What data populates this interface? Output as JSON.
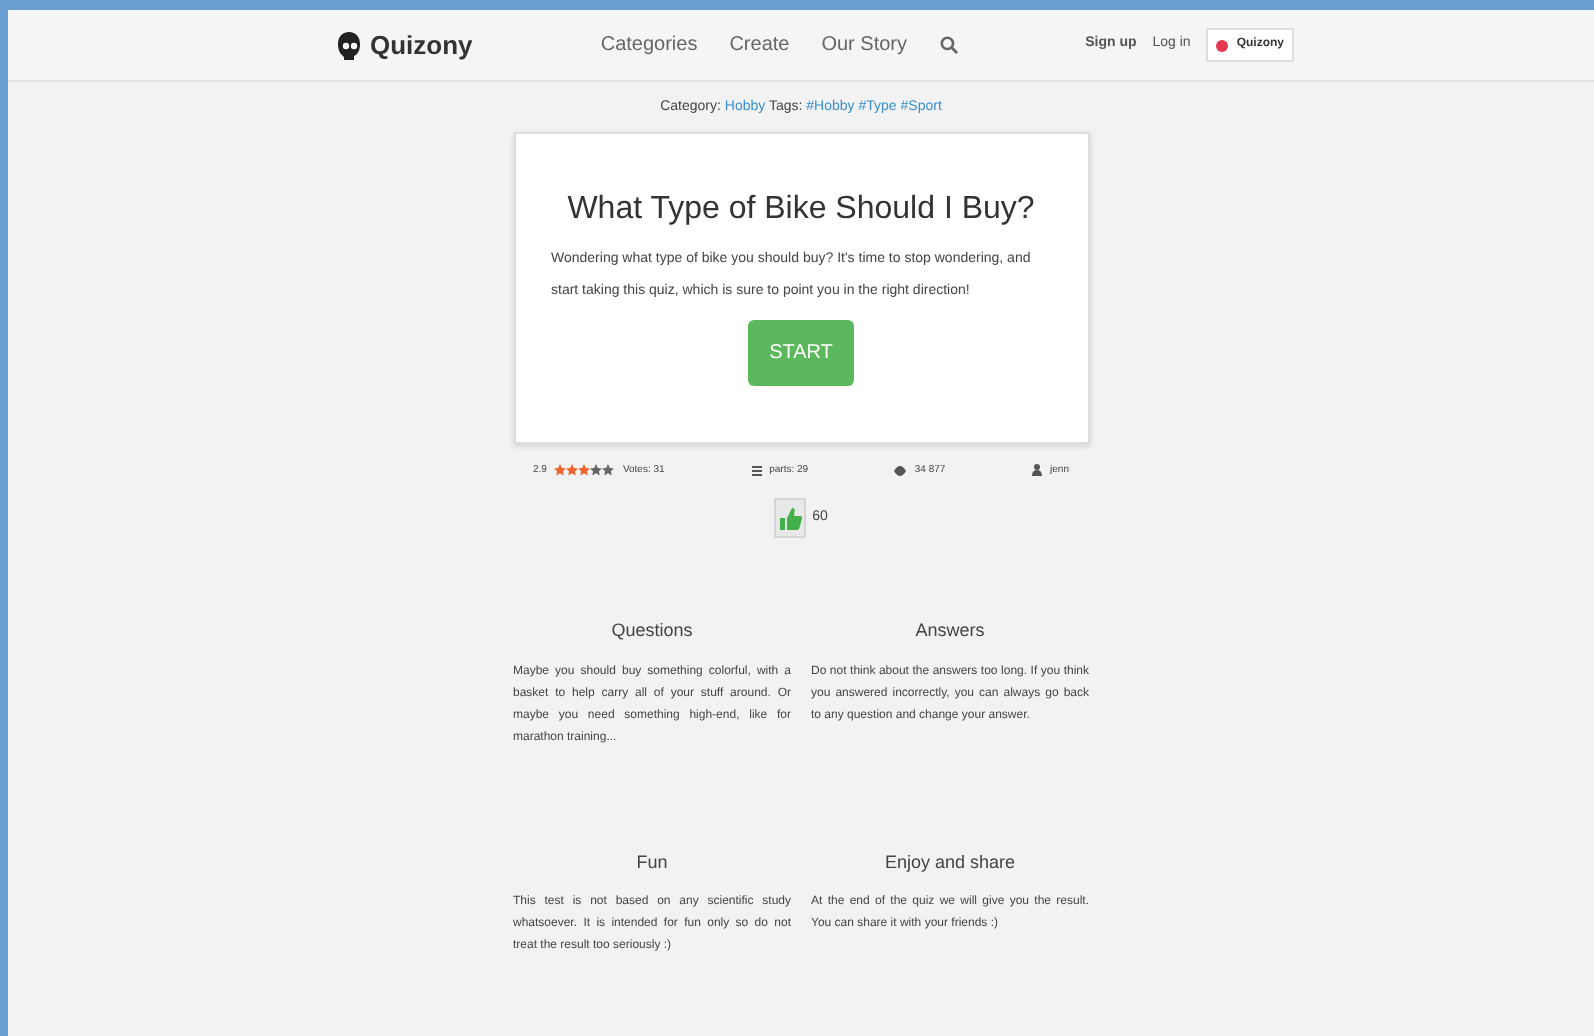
{
  "navbar": {
    "brand": "Quizony",
    "links": [
      "Categories",
      "Create",
      "Our Story"
    ],
    "right_links": [
      "Sign up",
      "Log in"
    ],
    "account_button": "Quizony"
  },
  "meta": {
    "category_label": "Category:",
    "category": "Hobby",
    "tags_label": "Tags:",
    "tags": [
      "#Hobby",
      "#Type",
      "#Sport"
    ]
  },
  "quiz": {
    "title": "What Type of Bike Should I Buy?",
    "description": "Wondering what type of bike you should buy? It's time to stop wondering, and start taking this quiz, which is sure to point you in the right direction!",
    "start_button": "START"
  },
  "stats": {
    "rating": "2.9",
    "stars": 3,
    "votes": "Votes: 31",
    "parts": "parts: 29",
    "views": "34 877",
    "author": "jenn"
  },
  "likes": "60",
  "features": [
    {
      "title": "Questions",
      "text": "Maybe you should buy something colorful, with a basket to help carry all of your stuff around. Or maybe you need something high-end, like for marathon training..."
    },
    {
      "title": "Answers",
      "text": "Do not think about the answers too long. If you think you answered incorrectly, you can always go back to any question and change your answer."
    },
    {
      "title": "Fun",
      "text": "This test is not based on any scientific study whatsoever. It is intended for fun only so do not treat the result too seriously :)"
    },
    {
      "title": "Enjoy and share",
      "text": "At the end of the quiz we will give you the result. You can share it with your friends :)"
    }
  ]
}
